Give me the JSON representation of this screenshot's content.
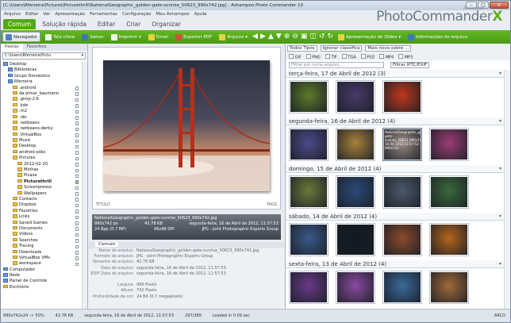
{
  "title": "[C:\\Users\\Rferreira\\Pictures\\Picturethrill\\NationalGeographic_golden-gate-sunrise_50623_990x742.jpg] - Ashampoo Photo Commander 10",
  "menu": [
    "Arquivo",
    "Editar",
    "Ver",
    "Apresentação",
    "Ferramentas",
    "Configuração",
    "Meu Ashampoo",
    "Ajuda"
  ],
  "logo": {
    "brand": "Ashampoo®",
    "name": "PhotoCommander",
    "x": "X"
  },
  "tabs": [
    "Comum",
    "Solução rápida",
    "Editar",
    "Criar",
    "Organizar"
  ],
  "ribbon": {
    "navegador": "Navegador",
    "tela_cheia": "Tela cheia",
    "salvar": "Salvar",
    "imprimir": "Imprimir",
    "email": "Email",
    "exportar_pdf": "Exportar PDF",
    "arquivo": "Arquivo",
    "apresentacao": "Apresentação de Slides",
    "informacoes": "Informações do arquivo"
  },
  "left": {
    "tab1": "Pastas",
    "tab2": "Favoritos",
    "path": "C:\\Users\\Rferreira\\Pictu",
    "tree": [
      "Desktop",
      "Bibliotecas",
      "Grupo Doméstico",
      "Rferreira",
      ".android",
      "da.elmar_baumann",
      ".gimp-2.6",
      ".kde",
      ".m2",
      ".nbi",
      ".netbeans",
      ".netbeans-derby",
      ".VirtualBox",
      "Music",
      "Desktop",
      "android-sdks",
      "Pictures",
      "2012-02-20",
      "Minhas",
      "Picasa",
      "Picturethrill",
      "Screenpresso",
      "Wallpapers",
      "Contacts",
      "Dropbox",
      "Favorites",
      "Links",
      "Saved Games",
      "Documents",
      "Videos",
      "Searches",
      "Tracing",
      "Downloads",
      "VirtualBox VMs",
      "workspace",
      "Computador",
      "Rede",
      "Painel de Controle",
      "Escritório"
    ]
  },
  "viewer": {
    "titulo": "TÍTULO",
    "tags": "TAGS"
  },
  "info": {
    "filename": "NationalGeographic_golden-gate-sunrise_50623_990x742.jpg",
    "dims": "990x742 px",
    "size": "42.78 KB",
    "date": "segunda-feira, 16 de Abril de 2012, 11:57:53",
    "bpp": "24 Bpp (0.7 MP)",
    "dpi": "96x96 DPI",
    "format": "JPG - Joint Photographic Experts Group"
  },
  "props": {
    "tab": "Comum",
    "rows": [
      {
        "k": "Nome do arquivo:",
        "v": "NationalGeographic_golden-gate-sunrise_50623_990x742.jpg"
      },
      {
        "k": "Formato do arquivo:",
        "v": "JPG - Joint Photographic Experts Group"
      },
      {
        "k": "Tamanho do arquivo:",
        "v": "42.78 KB"
      },
      {
        "k": "Data do arquivo:",
        "v": "segunda-feira, 16 de Abril de 2012, 11:57:53"
      },
      {
        "k": "EXIF Data do arquivo:",
        "v": "segunda-feira, 16 de Abril de 2012, 11:57:53"
      },
      {
        "k": "",
        "v": ""
      },
      {
        "k": "Largura:",
        "v": "990 Pixels"
      },
      {
        "k": "Altura:",
        "v": "742 Pixels"
      },
      {
        "k": "Profundidade de cor:",
        "v": "24 Bit (0.7 megapixels)"
      }
    ]
  },
  "right": {
    "sort1": "Todos Tipos",
    "sort2": "Ignorar classifica",
    "sort3": "Mais novo sobre ...",
    "types": [
      "GIF",
      "PNG",
      "TIF",
      "TGA",
      "PSD",
      "MP4",
      "MP3"
    ],
    "filter": "Filtrar por nome arquivo...",
    "ipct": "Filtrar IPTC/EXIF",
    "days": [
      {
        "label": "terça-feira, 17 de Abril de 2012 (3)",
        "colors": [
          "#5c7a2a",
          "#4a3a6a",
          "#c0361c"
        ],
        "sel": -1
      },
      {
        "label": "segunda-feira, 16 de Abril de 2012 (4)",
        "colors": [
          "#4d4a8a",
          "#a7813a",
          "#9a8a82",
          "#9d3d74"
        ],
        "sel": 2
      },
      {
        "label": "domingo, 15 de Abril de 2012 (4)",
        "colors": [
          "#6a7a3a",
          "#2b4a7a",
          "#4b5a6a",
          "#3a6a3a"
        ],
        "sel": -1
      },
      {
        "label": "sábado, 14 de Abril de 2012 (4)",
        "colors": [
          "#3a5a8a",
          "#111822",
          "#8a4a2a",
          "#b5651d"
        ],
        "sel": -1
      },
      {
        "label": "sexta-feira, 13 de Abril de 2012 (4)",
        "colors": [
          "#6a3a8a",
          "#8a4aa0",
          "#3a6a9a",
          "#a06a3a"
        ],
        "sel": -1
      }
    ],
    "selected_caption": "NationalGeographic_golden-gate-sunrise_50623_990x742.jpg 16-04-2012 11:57:53 990x742"
  },
  "status": {
    "dims": "990x742x24 -> 50%",
    "size": "42.78 KB",
    "date": "segunda-feira, 16 de Abril de 2012, 11:57:53",
    "count": "297/389",
    "load": "Loaded in 0.09 sec",
    "zoom": "ARCO"
  }
}
